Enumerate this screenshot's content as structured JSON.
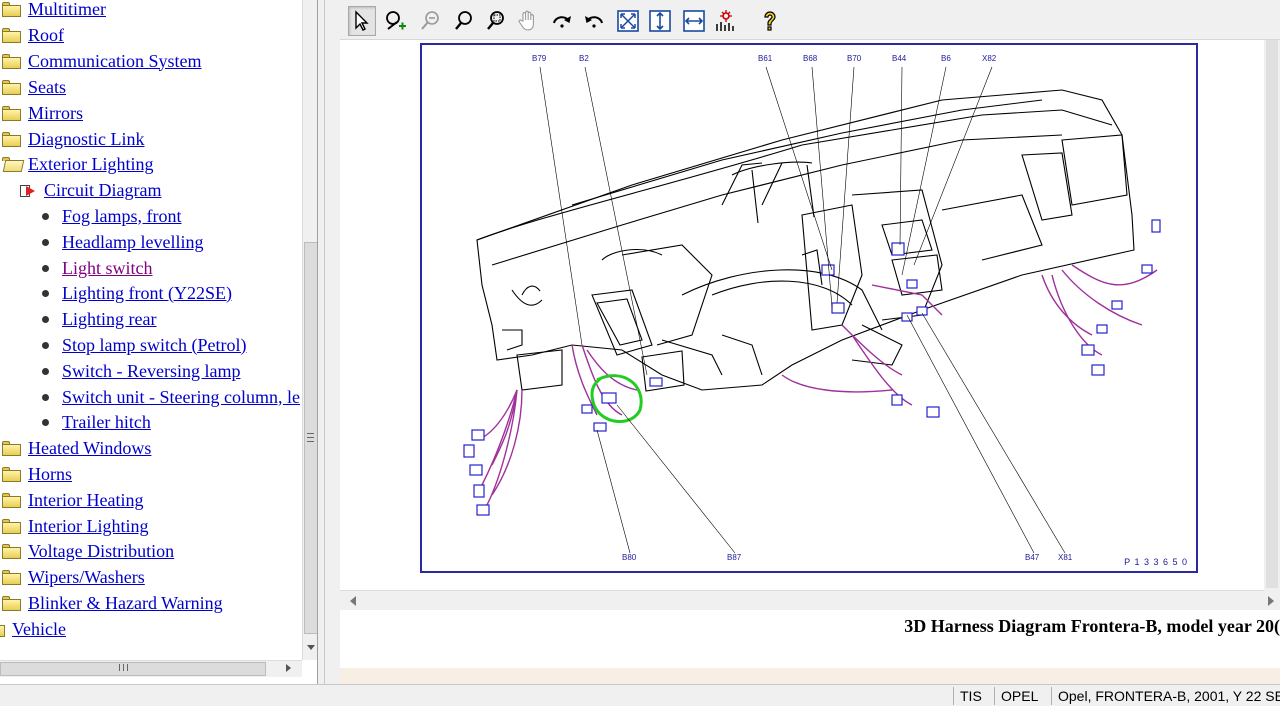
{
  "tree": {
    "items": [
      {
        "label": "Multitimer",
        "icon": "folder-icon",
        "visited": false
      },
      {
        "label": "Roof",
        "icon": "folder-icon",
        "visited": false
      },
      {
        "label": "Communication System",
        "icon": "folder-icon",
        "visited": false
      },
      {
        "label": "Seats",
        "icon": "folder-icon",
        "visited": false
      },
      {
        "label": "Mirrors",
        "icon": "folder-icon",
        "visited": false
      },
      {
        "label": "Diagnostic Link",
        "icon": "folder-icon",
        "visited": false
      },
      {
        "label": "Exterior Lighting",
        "icon": "folder-open-icon",
        "visited": false
      },
      {
        "label": "Circuit Diagram",
        "icon": "document-icon",
        "visited": false
      },
      {
        "label": "Fog lamps, front",
        "icon": "bullet-icon",
        "visited": false
      },
      {
        "label": "Headlamp levelling",
        "icon": "bullet-icon",
        "visited": false
      },
      {
        "label": "Light switch",
        "icon": "bullet-icon",
        "visited": true
      },
      {
        "label": "Lighting front (Y22SE)",
        "icon": "bullet-icon",
        "visited": false
      },
      {
        "label": "Lighting rear",
        "icon": "bullet-icon",
        "visited": false
      },
      {
        "label": "Stop lamp switch (Petrol)",
        "icon": "bullet-icon",
        "visited": false
      },
      {
        "label": "Switch - Reversing lamp",
        "icon": "bullet-icon",
        "visited": false
      },
      {
        "label": "Switch unit - Steering column, le",
        "icon": "bullet-icon",
        "visited": false
      },
      {
        "label": "Trailer hitch",
        "icon": "bullet-icon",
        "visited": false
      },
      {
        "label": "Heated Windows",
        "icon": "folder-icon",
        "visited": false
      },
      {
        "label": "Horns",
        "icon": "folder-icon",
        "visited": false
      },
      {
        "label": "Interior Heating",
        "icon": "folder-icon",
        "visited": false
      },
      {
        "label": "Interior Lighting",
        "icon": "folder-icon",
        "visited": false
      },
      {
        "label": "Voltage Distribution",
        "icon": "folder-icon",
        "visited": false
      },
      {
        "label": "Wipers/Washers",
        "icon": "folder-icon",
        "visited": false
      },
      {
        "label": "Blinker & Hazard Warning",
        "icon": "folder-icon",
        "visited": false
      },
      {
        "label": "Vehicle",
        "icon": "folder-icon",
        "visited": false
      }
    ]
  },
  "toolbar": {
    "buttons": [
      "select-arrow-icon",
      "zoom-in-icon",
      "zoom-out-icon",
      "zoom-icon",
      "zoom-area-icon",
      "pan-hand-icon",
      "rotate-cw-icon",
      "rotate-ccw-icon",
      "fit-page-icon",
      "fit-height-icon",
      "fit-width-icon",
      "reset-view-icon",
      "help-icon"
    ]
  },
  "diagram": {
    "callouts_top": [
      "B79",
      "B2",
      "B61",
      "B68",
      "B70",
      "B44",
      "B6",
      "X82"
    ],
    "callouts_bottom": [
      "B80",
      "B87",
      "B47",
      "X81"
    ],
    "code": "P 1 3 3 6 5 0",
    "colors": {
      "frame": "#2a2aa0",
      "wire": "#a0309a",
      "connector": "#2222cc",
      "highlight": "#22cc22"
    }
  },
  "caption": "3D Harness Diagram Frontera-B, model year 20(",
  "statusbar": {
    "field1": "TIS",
    "field2": "OPEL",
    "field3": "Opel, FRONTERA-B, 2001, Y 22 SE"
  }
}
